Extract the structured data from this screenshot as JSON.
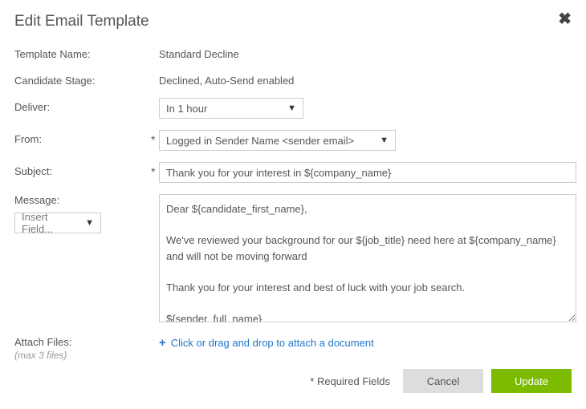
{
  "title": "Edit Email Template",
  "fields": {
    "templateName": {
      "label": "Template Name:",
      "value": "Standard Decline"
    },
    "candidateStage": {
      "label": "Candidate Stage:",
      "value": "Declined, Auto-Send enabled"
    },
    "deliver": {
      "label": "Deliver:",
      "value": "In 1 hour"
    },
    "from": {
      "label": "From:",
      "value": "Logged in Sender Name <sender email>",
      "required": "*"
    },
    "subject": {
      "label": "Subject:",
      "value": "Thank you for your interest in ${company_name}",
      "required": "*"
    },
    "message": {
      "label": "Message:",
      "insertField": "Insert Field...",
      "value": "Dear ${candidate_first_name},\n\nWe've reviewed your background for our ${job_title} need here at ${company_name} and will not be moving forward\n\nThank you for your interest and best of luck with your job search.\n\n${sender_full_name}\n${sender_job_title}"
    },
    "attach": {
      "label": "Attach Files:",
      "note": "(max 3 files)",
      "link": "Click or drag and drop to attach a document"
    }
  },
  "footer": {
    "requiredNote": "* Required Fields",
    "cancel": "Cancel",
    "update": "Update"
  }
}
